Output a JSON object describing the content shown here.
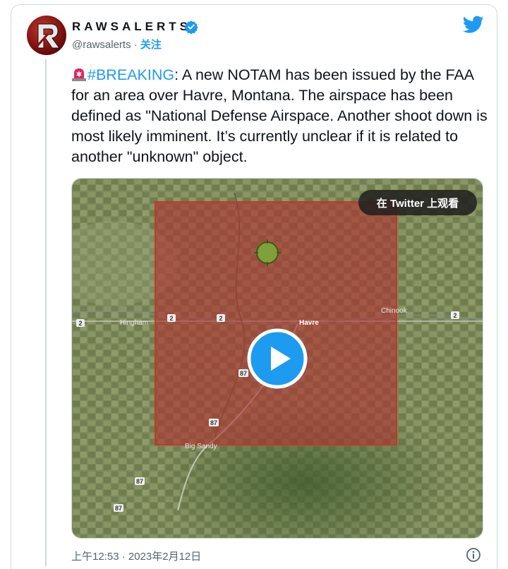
{
  "author": {
    "display_name": "RAWSALERTS",
    "handle": "@rawsalerts",
    "separator": " · ",
    "follow_label": "关注",
    "verified": true
  },
  "tweet": {
    "hashtag": "#BREAKING",
    "body": ": A new NOTAM has been issued by the FAA for an area over Havre, Montana. The airspace has been defined as \"National Defense Airspace. Another shoot down is most likely imminent. It’s currently unclear if it is related to another \"unknown\" object."
  },
  "media": {
    "watch_on_twitter_label": "在 Twitter 上观看",
    "map_labels": {
      "town_havre": "Havre",
      "town_hingham": "Hingham",
      "town_chinook": "Chinook",
      "town_big_sandy": "Big Sandy",
      "route_2_a": "2",
      "route_2_b": "2",
      "route_2_c": "2",
      "route_2_d": "2",
      "route_87_a": "87",
      "route_87_b": "87",
      "route_87_c": "87",
      "route_87_d": "87"
    }
  },
  "footer": {
    "timestamp": "上午12:53 · 2023年2月12日"
  },
  "colors": {
    "link": "#1d9bf0",
    "secondary_text": "#536471",
    "restricted_zone": "#c0392b"
  }
}
